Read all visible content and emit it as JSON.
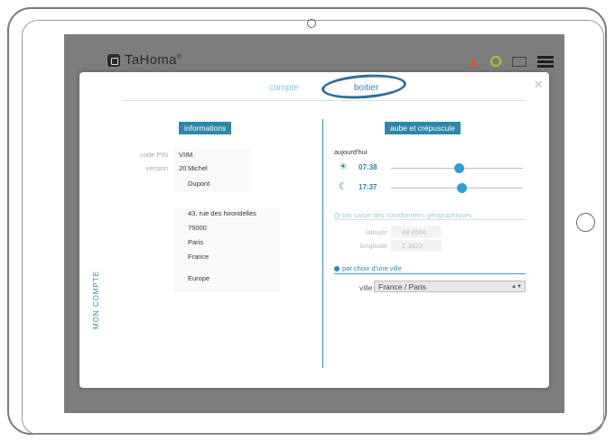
{
  "header": {
    "app_name": "TaHoma",
    "trademark": "®",
    "icons": [
      "warning-icon",
      "user-icon",
      "mail-icon",
      "menu-icon"
    ],
    "accent_color": "#2e87a8"
  },
  "modal": {
    "close_glyph": "×",
    "tabs": [
      {
        "label": "compte",
        "active": false
      },
      {
        "label": "boitier",
        "active": true
      }
    ],
    "side_title": "MON COMPTE",
    "informations": {
      "title": "informations",
      "code_pin_label": "code PIN",
      "code_pin_value": "VIIM.",
      "version_label": "version",
      "version_value": "20",
      "first_name": "Michel",
      "last_name": "Dupont",
      "address_street": "43, rue des hirondelles",
      "address_zip": "75000",
      "address_city": "Paris",
      "address_country": "France",
      "region": "Europe"
    },
    "sun": {
      "title": "aube et crépuscule",
      "today_label": "aujourd'hui",
      "sunrise_time": "07:38",
      "sunset_time": "17:37",
      "sunrise_slider_fraction": 0.52,
      "sunset_slider_fraction": 0.54,
      "option_coords_label": "par saisie des coordonnées géographiques",
      "option_coords_selected": false,
      "latitude_label": "latitude",
      "latitude_value": "48.8566",
      "longitude_label": "longitude",
      "longitude_value": "2.3522",
      "option_city_label": "par choix d'une ville",
      "option_city_selected": true,
      "city_label": "ville",
      "city_value": "France / Paris"
    }
  }
}
